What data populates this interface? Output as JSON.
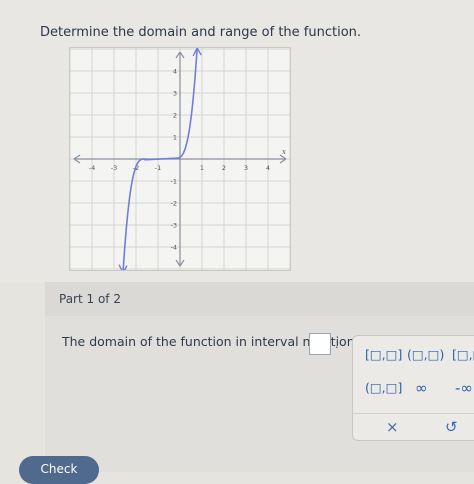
{
  "question": "Determine the domain and range of the function.",
  "graph": {
    "x_tick_labels": [
      "-4",
      "-3",
      "-2",
      "-1",
      "1",
      "2",
      "3",
      "4"
    ],
    "y_tick_labels": [
      "4",
      "3",
      "2",
      "1",
      "-1",
      "-2",
      "-3",
      "-4"
    ],
    "x_axis_label": "x",
    "x_range": [
      -5,
      5
    ],
    "y_range": [
      -5,
      5
    ],
    "curve_color": "#6f7fd8"
  },
  "part": {
    "label": "Part 1 of 2",
    "prompt": "The domain of the function in interval notation is",
    "dot": "."
  },
  "palette": {
    "closed_interval": "[□,□]",
    "open_interval": "(□,□)",
    "half_open_left": "[□,□",
    "open_closed": "(□,□]",
    "infinity": "∞",
    "neg_infinity": "-∞",
    "clear": "×",
    "undo": "↺"
  },
  "check_label": "Check",
  "colors": {
    "accent": "#2d5ea8",
    "check_bg": "#506a8e"
  }
}
